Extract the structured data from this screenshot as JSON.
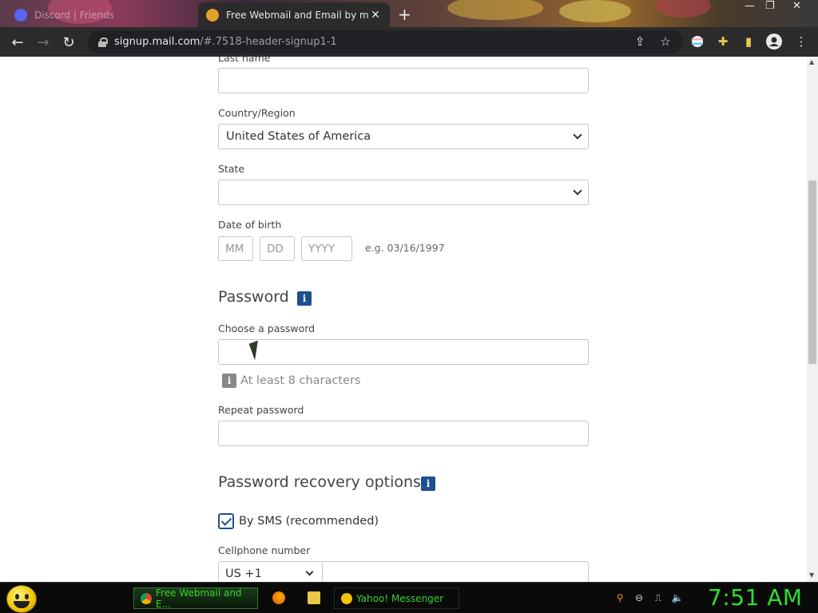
{
  "browser": {
    "tabs": [
      {
        "title": "Discord | Friends",
        "icon": "discord-icon",
        "active": false
      },
      {
        "title": "Free Webmail and Email by mail",
        "icon": "mailcom-icon",
        "active": true
      }
    ],
    "new_tab_glyph": "+",
    "url_host": "signup.mail.com",
    "url_path": "/#.7518-header-signup1-1"
  },
  "form": {
    "last_name_label": "Last name",
    "country_label": "Country/Region",
    "country_value": "United States of America",
    "state_label": "State",
    "state_value": "",
    "dob_label": "Date of birth",
    "dob_mm_placeholder": "MM",
    "dob_dd_placeholder": "DD",
    "dob_yyyy_placeholder": "YYYY",
    "dob_hint": "e.g. 03/16/1997",
    "password_heading": "Password",
    "choose_password_label": "Choose a password",
    "password_hint": "At least 8 characters",
    "repeat_password_label": "Repeat password",
    "recovery_heading": "Password recovery options",
    "sms_label": "By SMS (recommended)",
    "sms_checked": true,
    "cellphone_label": "Cellphone number",
    "country_code_value": "US +1",
    "info_glyph": "i"
  },
  "taskbar": {
    "tasks": [
      {
        "label": "Free Webmail and E...",
        "icon": "chrome-icon"
      },
      {
        "label": "Yahoo! Messenger",
        "icon": "yahoo-messenger-icon"
      }
    ],
    "clock": "7:51 AM"
  },
  "colors": {
    "accent": "#1d4f91",
    "clock": "#2ee02e",
    "taskbar_text": "#3bd12b"
  }
}
